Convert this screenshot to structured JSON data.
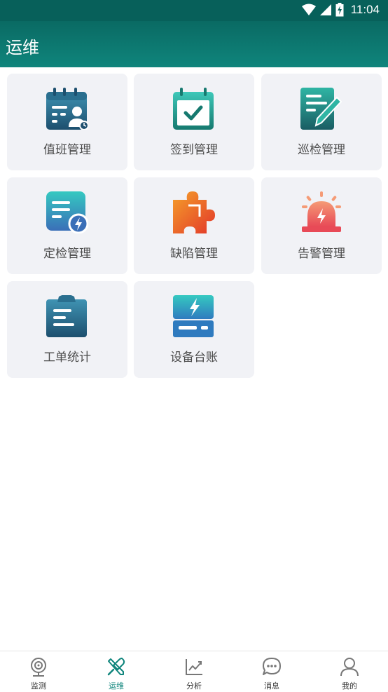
{
  "status_bar": {
    "time": "11:04"
  },
  "app_bar": {
    "title": "运维"
  },
  "tiles": [
    {
      "label": "值班管理",
      "icon": "duty-calendar-icon"
    },
    {
      "label": "签到管理",
      "icon": "checkin-calendar-icon"
    },
    {
      "label": "巡检管理",
      "icon": "inspection-document-icon"
    },
    {
      "label": "定检管理",
      "icon": "scheduled-inspection-icon"
    },
    {
      "label": "缺陷管理",
      "icon": "defect-puzzle-icon"
    },
    {
      "label": "告警管理",
      "icon": "alarm-siren-icon"
    },
    {
      "label": "工单统计",
      "icon": "work-order-clipboard-icon"
    },
    {
      "label": "设备台账",
      "icon": "equipment-ledger-icon"
    }
  ],
  "bottom_nav": [
    {
      "label": "监测",
      "icon": "monitor-camera-icon",
      "active": false
    },
    {
      "label": "运维",
      "icon": "tools-icon",
      "active": true
    },
    {
      "label": "分析",
      "icon": "analysis-chart-icon",
      "active": false
    },
    {
      "label": "消息",
      "icon": "message-bubble-icon",
      "active": false
    },
    {
      "label": "我的",
      "icon": "user-profile-icon",
      "active": false
    }
  ],
  "colors": {
    "app_bar": "#0f857c",
    "status_bar": "#07605a",
    "tile_background": "#f1f2f6",
    "nav_active": "#0f857c"
  }
}
